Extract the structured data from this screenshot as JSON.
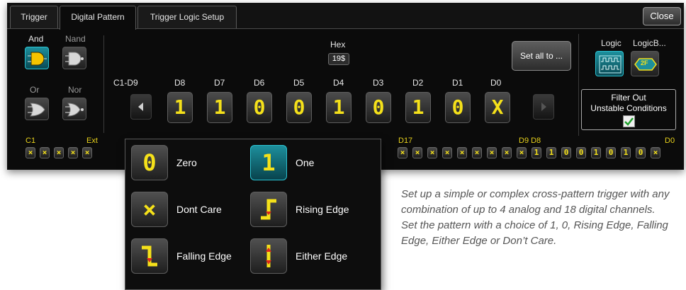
{
  "tabs": {
    "trigger": "Trigger",
    "digital_pattern": "Digital Pattern",
    "logic_setup": "Trigger Logic Setup",
    "close": "Close"
  },
  "gates": {
    "and": "And",
    "nand": "Nand",
    "or": "Or",
    "nor": "Nor"
  },
  "hex": {
    "label": "Hex",
    "value": "19$"
  },
  "set_all": "Set all to ...",
  "group_label": "C1-D9",
  "bit_labels": [
    "D8",
    "D7",
    "D6",
    "D5",
    "D4",
    "D3",
    "D2",
    "D1",
    "D0"
  ],
  "bits": [
    "1",
    "1",
    "0",
    "0",
    "1",
    "0",
    "1",
    "0",
    "X"
  ],
  "logic": {
    "logic_label": "Logic",
    "logicbus_label": "LogicB...",
    "bus_badge": "2F"
  },
  "filter": {
    "line1": "Filter Out",
    "line2": "Unstable Conditions",
    "checked": true
  },
  "analog_row": {
    "start": "C1",
    "end": "Ext",
    "chips": [
      "×",
      "×",
      "×",
      "×",
      "×"
    ]
  },
  "digital_row": {
    "start": "D17",
    "mid": "D9 D8",
    "end": "D0",
    "chips": [
      "×",
      "×",
      "×",
      "×",
      "×",
      "×",
      "×",
      "×",
      "×",
      "1",
      "1",
      "0",
      "0",
      "1",
      "0",
      "1",
      "0",
      "×"
    ]
  },
  "options": [
    {
      "symbol": "0",
      "label": "Zero"
    },
    {
      "symbol": "1",
      "label": "One"
    },
    {
      "symbol": "×",
      "label": "Dont Care"
    },
    {
      "symbol": "rising",
      "label": "Rising Edge"
    },
    {
      "symbol": "falling",
      "label": "Falling Edge"
    },
    {
      "symbol": "either",
      "label": "Either Edge"
    }
  ],
  "caption": "Set up a simple or complex cross-pattern trigger with any combination of up to 4 analog and 18 digital channels. Set the pattern with a choice of 1, 0, Rising Edge, Falling Edge, Either Edge or Don’t Care.",
  "colors": {
    "accent": "#1d8f9c",
    "digit": "#f5e11a",
    "panel": "#0b0b0b"
  }
}
